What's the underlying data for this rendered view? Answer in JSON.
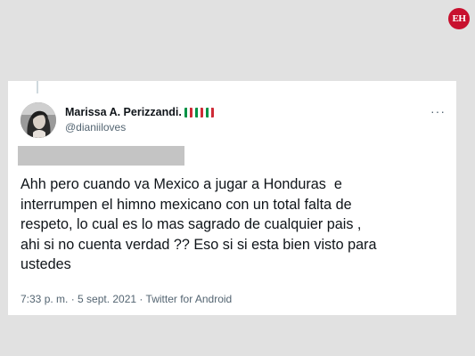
{
  "watermark": {
    "logo_text": "EH",
    "logo_color": "#c8102e"
  },
  "tweet": {
    "display_name": "Marissa A. Perizzandi.",
    "flags": [
      "italy-flag",
      "italy-flag",
      "italy-flag"
    ],
    "handle": "@dianiiloves",
    "more_icon": "···",
    "text": "Ahh pero cuando va Mexico a jugar a Honduras  e\ninterrumpen el himno mexicano con un total falta de\nrespeto, lo cual es lo mas sagrado de cualquier pais ,\nahi si no cuenta verdad ?? Eso si si esta bien visto para\nustedes",
    "meta": "7:33 p. m. · 5 sept. 2021 · Twitter for Android"
  },
  "colors": {
    "flag_green": "#009246",
    "flag_white": "#ffffff",
    "flag_red": "#ce2b37"
  }
}
